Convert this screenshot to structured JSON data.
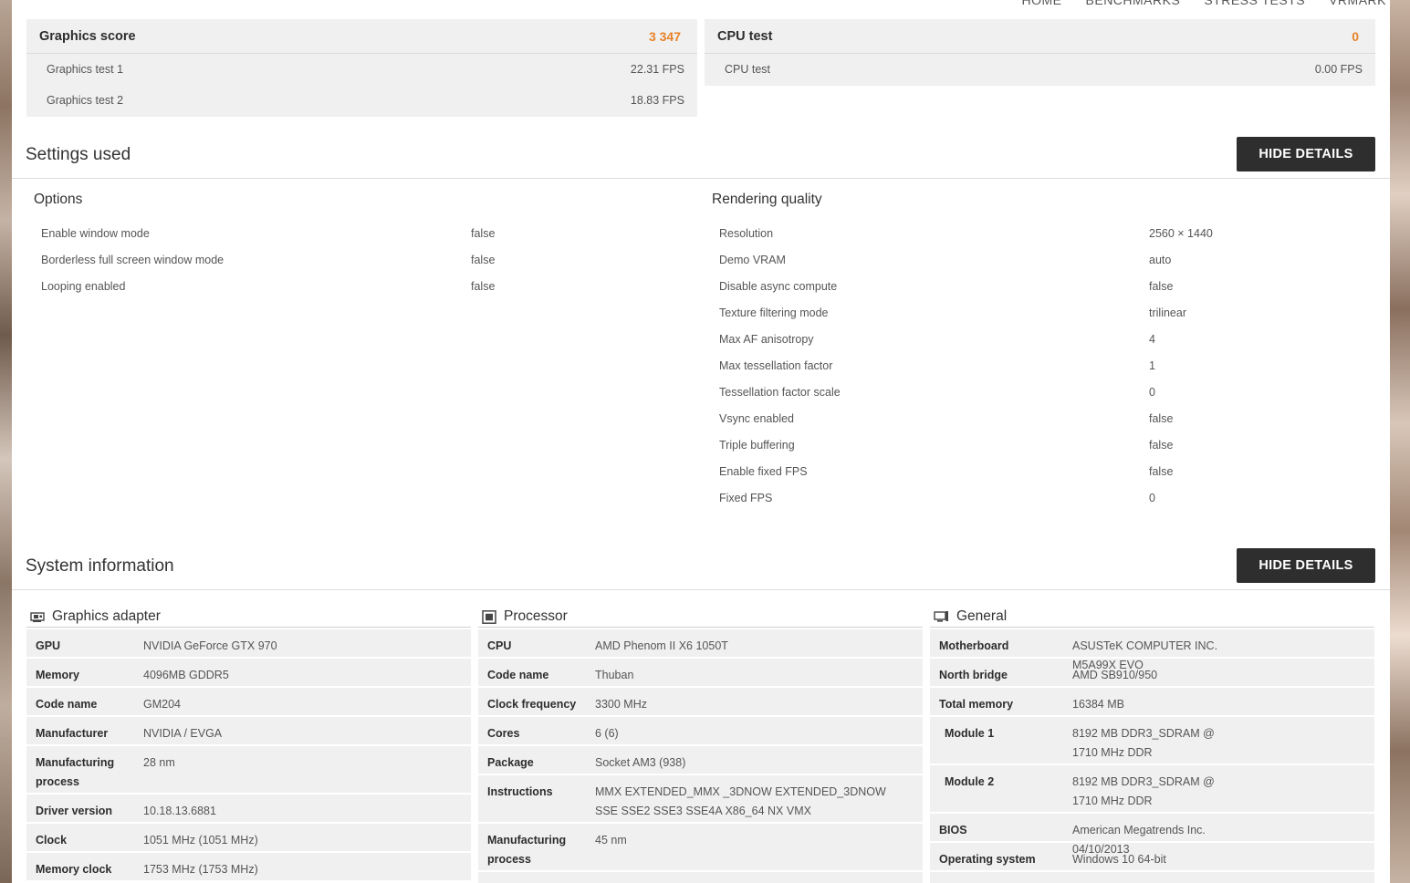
{
  "nav": [
    "HOME",
    "BENCHMARKS",
    "STRESS TESTS",
    "VRMARK"
  ],
  "graphics_panel": {
    "title": "Graphics score",
    "score": "3 347",
    "rows": [
      {
        "label": "Graphics test 1",
        "value": "22.31 FPS"
      },
      {
        "label": "Graphics test 2",
        "value": "18.83 FPS"
      }
    ]
  },
  "cpu_panel": {
    "title": "CPU test",
    "score": "0",
    "rows": [
      {
        "label": "CPU test",
        "value": "0.00 FPS"
      }
    ]
  },
  "settings": {
    "title": "Settings used",
    "button": "HIDE DETAILS",
    "options": {
      "title": "Options",
      "rows": [
        {
          "label": "Enable window mode",
          "value": "false"
        },
        {
          "label": "Borderless full screen window mode",
          "value": "false"
        },
        {
          "label": "Looping enabled",
          "value": "false"
        }
      ]
    },
    "rendering": {
      "title": "Rendering quality",
      "rows": [
        {
          "label": "Resolution",
          "value": "2560 × 1440"
        },
        {
          "label": "Demo VRAM",
          "value": "auto"
        },
        {
          "label": "Disable async compute",
          "value": "false"
        },
        {
          "label": "Texture filtering mode",
          "value": "trilinear"
        },
        {
          "label": "Max AF anisotropy",
          "value": "4"
        },
        {
          "label": "Max tessellation factor",
          "value": "1"
        },
        {
          "label": "Tessellation factor scale",
          "value": "0"
        },
        {
          "label": "Vsync enabled",
          "value": "false"
        },
        {
          "label": "Triple buffering",
          "value": "false"
        },
        {
          "label": "Enable fixed FPS",
          "value": "false"
        },
        {
          "label": "Fixed FPS",
          "value": "0"
        }
      ]
    }
  },
  "system": {
    "title": "System information",
    "button": "HIDE DETAILS",
    "graphics": {
      "title": "Graphics adapter",
      "icon": "graphics-card-icon",
      "rows": [
        {
          "label": "GPU",
          "value": "NVIDIA GeForce GTX 970"
        },
        {
          "label": "Memory",
          "value": "4096MB GDDR5"
        },
        {
          "label": "Code name",
          "value": "GM204"
        },
        {
          "label": "Manufacturer",
          "value": "NVIDIA / EVGA"
        },
        {
          "label": "Manufacturing process",
          "value": "28 nm"
        },
        {
          "label": "Driver version",
          "value": "10.18.13.6881"
        },
        {
          "label": "Clock",
          "value": "1051 MHz (1051 MHz)"
        },
        {
          "label": "Memory clock",
          "value": "1753 MHz (1753 MHz)"
        }
      ]
    },
    "processor": {
      "title": "Processor",
      "icon": "cpu-chip-icon",
      "rows": [
        {
          "label": "CPU",
          "value": "AMD Phenom II X6 1050T"
        },
        {
          "label": "Code name",
          "value": "Thuban"
        },
        {
          "label": "Clock frequency",
          "value": "3300 MHz"
        },
        {
          "label": "Cores",
          "value": "6 (6)"
        },
        {
          "label": "Package",
          "value": "Socket AM3 (938)"
        },
        {
          "label": "Instructions",
          "value": "MMX EXTENDED_MMX _3DNOW EXTENDED_3DNOW SSE SSE2 SSE3 SSE4A X86_64 NX VMX"
        },
        {
          "label": "Manufacturing process",
          "value": "45 nm"
        }
      ]
    },
    "general": {
      "title": "General",
      "icon": "computer-icon",
      "rows": [
        {
          "label": "Motherboard",
          "value": "ASUSTeK COMPUTER INC. M5A99X EVO"
        },
        {
          "label": "North bridge",
          "value": "AMD SB910/950"
        },
        {
          "label": "Total memory",
          "value": "16384 MB"
        },
        {
          "label": "Module 1",
          "value": "8192 MB DDR3_SDRAM @ 1710 MHz DDR"
        },
        {
          "label": "Module 2",
          "value": "8192 MB DDR3_SDRAM @ 1710 MHz DDR"
        },
        {
          "label": "BIOS",
          "value": "American Megatrends Inc. 04/10/2013"
        },
        {
          "label": "Operating system",
          "value": "Windows 10 64-bit"
        }
      ]
    }
  }
}
